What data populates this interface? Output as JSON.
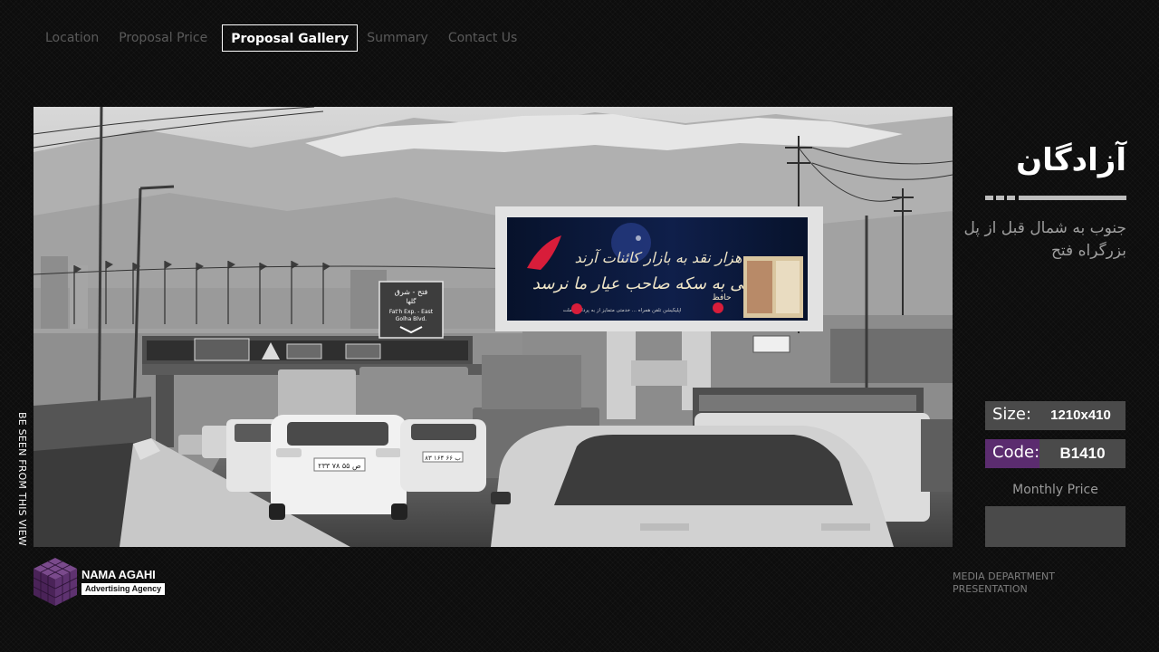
{
  "nav": {
    "items": [
      {
        "label": "Location",
        "active": false
      },
      {
        "label": "Proposal Price",
        "active": false
      },
      {
        "label": "Proposal Gallery",
        "active": true
      },
      {
        "label": "Summary",
        "active": false
      },
      {
        "label": "Contact Us",
        "active": false
      }
    ]
  },
  "photo": {
    "billboard_line1": "هزار نقد به بازار کائنات آرند",
    "billboard_line2": "یکی به سکه صاحب عیار ما نرسد",
    "billboard_author": "حافظ",
    "billboard_footer": "اپلیکیشن تلفن همراه ... خدمتی متمایز از به پرداخت ملت",
    "road_sign_line1": "فتح - شرق",
    "road_sign_line2": "گلها",
    "road_sign_line3": "Fat'h Exp. - East",
    "road_sign_line4": "Golha Blvd.",
    "plate_1": "۲۳۳ ۷۸ ص ۵۵",
    "plate_2": "۸۳ ۱۶۴ ب ۶۶"
  },
  "side_caption": "BE SEEN FROM THIS VIEW",
  "panel": {
    "title": "آزادگان",
    "subtitle": "جنوب به شمال قبل از پل بزرگراه فتح",
    "size_label": "Size:",
    "size_value": "1210x410",
    "code_label": "Code:",
    "code_value": "B1410",
    "monthly_label": "Monthly Price",
    "monthly_value": ""
  },
  "brand": {
    "name": "NAMA AGAHI",
    "tagline": "Advertising Agency"
  },
  "footer": {
    "dept_line1": "MEDIA DEPARTMENT",
    "dept_line2": "PRESENTATION"
  },
  "colors": {
    "background": "#0d0d0d",
    "nav_inactive": "#5a5a5a",
    "accent_purple": "#5b2c6f",
    "value_box": "#4a4a4a"
  },
  "icons": {
    "logo": "purple-cube-logo-icon"
  }
}
